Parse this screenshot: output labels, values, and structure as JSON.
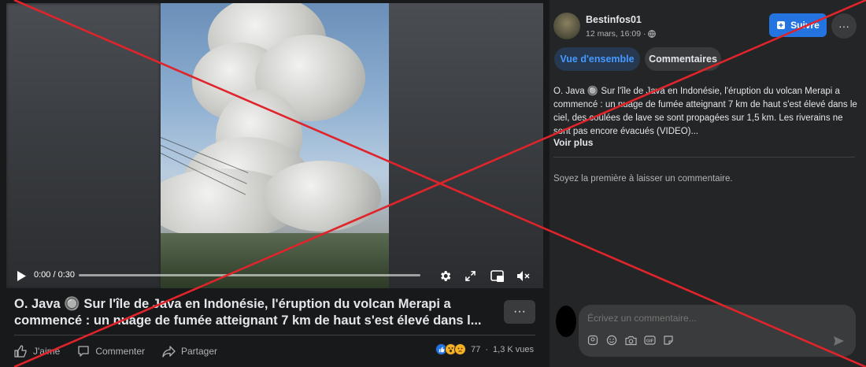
{
  "video": {
    "timecode": "0:00 / 0:30",
    "progress": 0
  },
  "post": {
    "title": "O. Java 🔘 Sur l'île de Java en Indonésie, l'éruption du volcan Merapi a commencé : un nuage de fumée atteignant 7 km de haut s'est élevé dans l...",
    "more_label": "···"
  },
  "actions": {
    "like": "J'aime",
    "comment": "Commenter",
    "share": "Partager"
  },
  "stats": {
    "reaction_count": "77",
    "separator": "·",
    "views": "1,3 K vues"
  },
  "sidebar": {
    "author": "Bestinfos01",
    "date": "12 mars, 16:09 ·",
    "save_label": "Suivre",
    "more_label": "···",
    "tabs": [
      {
        "label": "Vue d'ensemble"
      },
      {
        "label": "Commentaires"
      }
    ],
    "description": "O. Java 🔘 Sur l'île de Java en Indonésie, l'éruption du volcan Merapi a commencé : un nuage de fumée atteignant 7 km de haut s'est élevé dans le ciel, des coulées de lave se sont propagées sur 1,5 km. Les riverains ne sont pas encore évacués (VIDEO)...",
    "see_more": "Voir plus",
    "first_comment": "Soyez la première à laisser un commentaire.",
    "comment_placeholder": "Écrivez un commentaire..."
  },
  "colors": {
    "accent": "#2374e1",
    "tab_active_text": "#4599ff",
    "cross": "#e0242b"
  }
}
